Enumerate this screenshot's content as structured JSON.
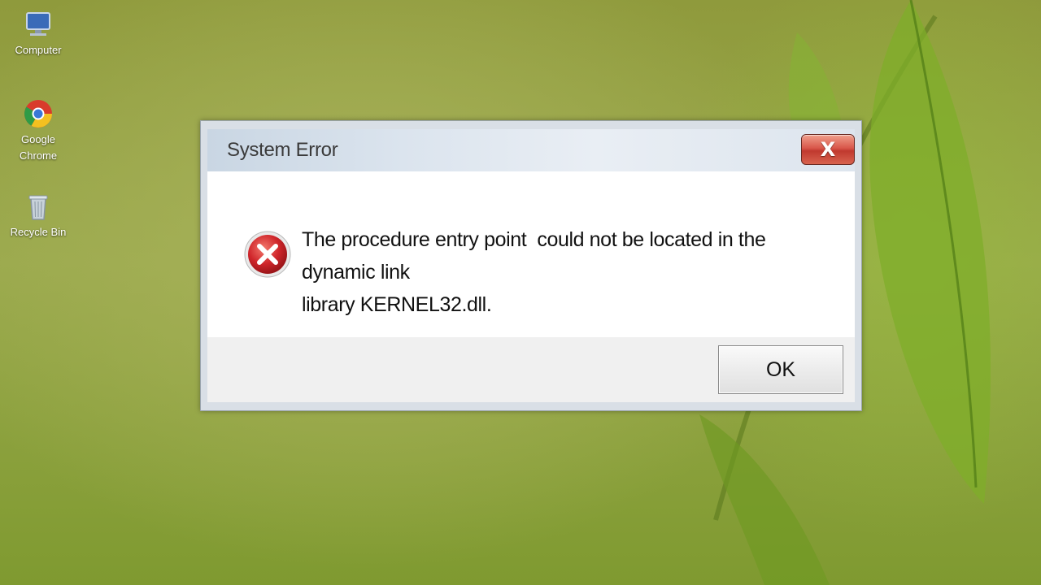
{
  "desktop": {
    "icons": [
      {
        "label": "Computer",
        "icon": "computer-icon"
      },
      {
        "label": "Google Chrome",
        "icon": "chrome-icon"
      },
      {
        "label": "Recycle Bin",
        "icon": "recycle-bin-icon"
      }
    ]
  },
  "dialog": {
    "title": "System Error",
    "close_label": "X",
    "icon": "error-icon",
    "message": "The procedure entry point  could not be located in the dynamic link\nlibrary KERNEL32.dll.",
    "ok_label": "OK"
  },
  "colors": {
    "close_button": "#c0392f",
    "error_icon": "#d0262b",
    "desktop_background": "#9aa94c"
  }
}
